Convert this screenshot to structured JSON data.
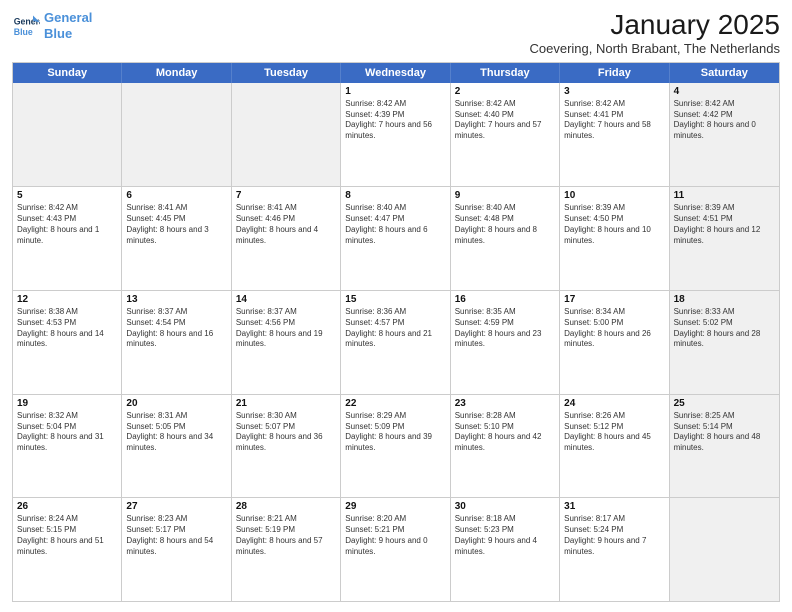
{
  "logo": {
    "line1": "General",
    "line2": "Blue"
  },
  "title": "January 2025",
  "subtitle": "Coevering, North Brabant, The Netherlands",
  "header_days": [
    "Sunday",
    "Monday",
    "Tuesday",
    "Wednesday",
    "Thursday",
    "Friday",
    "Saturday"
  ],
  "weeks": [
    [
      {
        "day": "",
        "text": "",
        "shaded": true
      },
      {
        "day": "",
        "text": "",
        "shaded": true
      },
      {
        "day": "",
        "text": "",
        "shaded": true
      },
      {
        "day": "1",
        "text": "Sunrise: 8:42 AM\nSunset: 4:39 PM\nDaylight: 7 hours and 56 minutes."
      },
      {
        "day": "2",
        "text": "Sunrise: 8:42 AM\nSunset: 4:40 PM\nDaylight: 7 hours and 57 minutes."
      },
      {
        "day": "3",
        "text": "Sunrise: 8:42 AM\nSunset: 4:41 PM\nDaylight: 7 hours and 58 minutes."
      },
      {
        "day": "4",
        "text": "Sunrise: 8:42 AM\nSunset: 4:42 PM\nDaylight: 8 hours and 0 minutes.",
        "shaded": true
      }
    ],
    [
      {
        "day": "5",
        "text": "Sunrise: 8:42 AM\nSunset: 4:43 PM\nDaylight: 8 hours and 1 minute."
      },
      {
        "day": "6",
        "text": "Sunrise: 8:41 AM\nSunset: 4:45 PM\nDaylight: 8 hours and 3 minutes."
      },
      {
        "day": "7",
        "text": "Sunrise: 8:41 AM\nSunset: 4:46 PM\nDaylight: 8 hours and 4 minutes."
      },
      {
        "day": "8",
        "text": "Sunrise: 8:40 AM\nSunset: 4:47 PM\nDaylight: 8 hours and 6 minutes."
      },
      {
        "day": "9",
        "text": "Sunrise: 8:40 AM\nSunset: 4:48 PM\nDaylight: 8 hours and 8 minutes."
      },
      {
        "day": "10",
        "text": "Sunrise: 8:39 AM\nSunset: 4:50 PM\nDaylight: 8 hours and 10 minutes."
      },
      {
        "day": "11",
        "text": "Sunrise: 8:39 AM\nSunset: 4:51 PM\nDaylight: 8 hours and 12 minutes.",
        "shaded": true
      }
    ],
    [
      {
        "day": "12",
        "text": "Sunrise: 8:38 AM\nSunset: 4:53 PM\nDaylight: 8 hours and 14 minutes."
      },
      {
        "day": "13",
        "text": "Sunrise: 8:37 AM\nSunset: 4:54 PM\nDaylight: 8 hours and 16 minutes."
      },
      {
        "day": "14",
        "text": "Sunrise: 8:37 AM\nSunset: 4:56 PM\nDaylight: 8 hours and 19 minutes."
      },
      {
        "day": "15",
        "text": "Sunrise: 8:36 AM\nSunset: 4:57 PM\nDaylight: 8 hours and 21 minutes."
      },
      {
        "day": "16",
        "text": "Sunrise: 8:35 AM\nSunset: 4:59 PM\nDaylight: 8 hours and 23 minutes."
      },
      {
        "day": "17",
        "text": "Sunrise: 8:34 AM\nSunset: 5:00 PM\nDaylight: 8 hours and 26 minutes."
      },
      {
        "day": "18",
        "text": "Sunrise: 8:33 AM\nSunset: 5:02 PM\nDaylight: 8 hours and 28 minutes.",
        "shaded": true
      }
    ],
    [
      {
        "day": "19",
        "text": "Sunrise: 8:32 AM\nSunset: 5:04 PM\nDaylight: 8 hours and 31 minutes."
      },
      {
        "day": "20",
        "text": "Sunrise: 8:31 AM\nSunset: 5:05 PM\nDaylight: 8 hours and 34 minutes."
      },
      {
        "day": "21",
        "text": "Sunrise: 8:30 AM\nSunset: 5:07 PM\nDaylight: 8 hours and 36 minutes."
      },
      {
        "day": "22",
        "text": "Sunrise: 8:29 AM\nSunset: 5:09 PM\nDaylight: 8 hours and 39 minutes."
      },
      {
        "day": "23",
        "text": "Sunrise: 8:28 AM\nSunset: 5:10 PM\nDaylight: 8 hours and 42 minutes."
      },
      {
        "day": "24",
        "text": "Sunrise: 8:26 AM\nSunset: 5:12 PM\nDaylight: 8 hours and 45 minutes."
      },
      {
        "day": "25",
        "text": "Sunrise: 8:25 AM\nSunset: 5:14 PM\nDaylight: 8 hours and 48 minutes.",
        "shaded": true
      }
    ],
    [
      {
        "day": "26",
        "text": "Sunrise: 8:24 AM\nSunset: 5:15 PM\nDaylight: 8 hours and 51 minutes."
      },
      {
        "day": "27",
        "text": "Sunrise: 8:23 AM\nSunset: 5:17 PM\nDaylight: 8 hours and 54 minutes."
      },
      {
        "day": "28",
        "text": "Sunrise: 8:21 AM\nSunset: 5:19 PM\nDaylight: 8 hours and 57 minutes."
      },
      {
        "day": "29",
        "text": "Sunrise: 8:20 AM\nSunset: 5:21 PM\nDaylight: 9 hours and 0 minutes."
      },
      {
        "day": "30",
        "text": "Sunrise: 8:18 AM\nSunset: 5:23 PM\nDaylight: 9 hours and 4 minutes."
      },
      {
        "day": "31",
        "text": "Sunrise: 8:17 AM\nSunset: 5:24 PM\nDaylight: 9 hours and 7 minutes."
      },
      {
        "day": "",
        "text": "",
        "shaded": true
      }
    ]
  ]
}
